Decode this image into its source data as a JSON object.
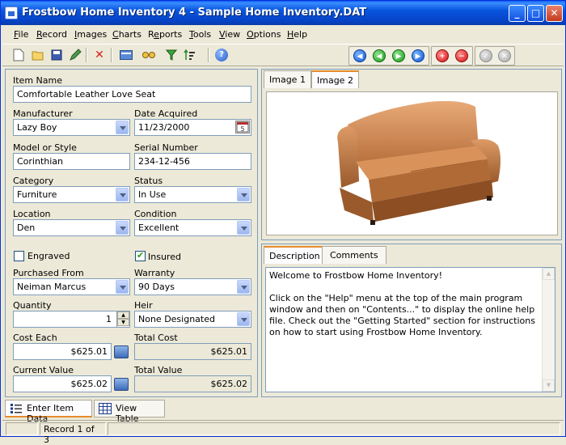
{
  "window": {
    "title": "Frostbow Home Inventory 4 - Sample Home Inventory.DAT"
  },
  "menu": [
    {
      "pre": "",
      "u": "F",
      "post": "ile"
    },
    {
      "pre": "",
      "u": "R",
      "post": "ecord"
    },
    {
      "pre": "",
      "u": "I",
      "post": "mages"
    },
    {
      "pre": "",
      "u": "C",
      "post": "harts"
    },
    {
      "pre": "R",
      "u": "e",
      "post": "ports"
    },
    {
      "pre": "",
      "u": "T",
      "post": "ools"
    },
    {
      "pre": "",
      "u": "V",
      "post": "iew"
    },
    {
      "pre": "",
      "u": "O",
      "post": "ptions"
    },
    {
      "pre": "",
      "u": "H",
      "post": "elp"
    }
  ],
  "form": {
    "item_name_label": "Item Name",
    "item_name": "Comfortable Leather Love Seat",
    "manufacturer_label": "Manufacturer",
    "manufacturer": "Lazy Boy",
    "date_acquired_label": "Date Acquired",
    "date_acquired": "11/23/2000",
    "model_label": "Model or Style",
    "model": "Corinthian",
    "serial_label": "Serial Number",
    "serial": "234-12-456",
    "category_label": "Category",
    "category": "Furniture",
    "status_label": "Status",
    "status": "In Use",
    "location_label": "Location",
    "location": "Den",
    "condition_label": "Condition",
    "condition": "Excellent",
    "engraved_label": "Engraved",
    "insured_label": "Insured",
    "purchased_from_label": "Purchased From",
    "purchased_from": "Neiman Marcus",
    "warranty_label": "Warranty",
    "warranty": "90 Days",
    "quantity_label": "Quantity",
    "quantity": "1",
    "heir_label": "Heir",
    "heir": "None Designated",
    "cost_each_label": "Cost Each",
    "cost_each": "$625.01",
    "total_cost_label": "Total Cost",
    "total_cost": "$625.01",
    "current_value_label": "Current Value",
    "current_value": "$625.02",
    "total_value_label": "Total Value",
    "total_value": "$625.02"
  },
  "checks": {
    "engraved": false,
    "insured": true
  },
  "image_tabs": [
    "Image 1",
    "Image 2"
  ],
  "desc_tabs": [
    "Description",
    "Comments"
  ],
  "description": [
    "Welcome to Frostbow Home Inventory!",
    "Click on the \"Help\" menu at the top of the main program window and then on \"Contents...\" to display the online help file.  Check out the \"Getting Started\" section for instructions on how to start using Frostbow Home Inventory."
  ],
  "bottom_tabs": [
    "Enter Item Data",
    "View Table"
  ],
  "status": {
    "record": "Record 1 of 3"
  }
}
